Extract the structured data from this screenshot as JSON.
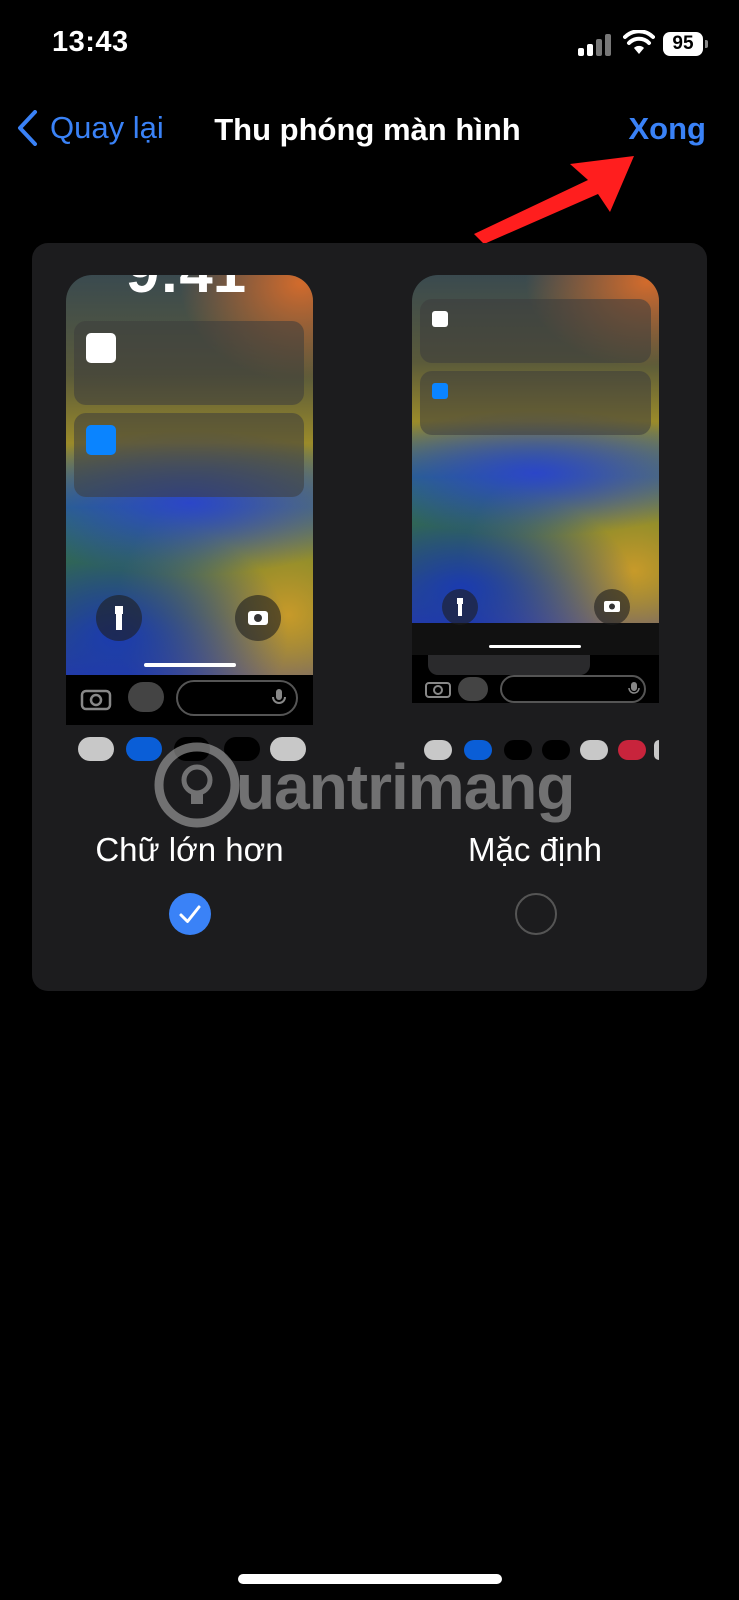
{
  "status_bar": {
    "time": "13:43",
    "battery": "95"
  },
  "nav": {
    "back_label": "Quay lại",
    "title": "Thu phóng màn hình",
    "done_label": "Xong"
  },
  "options": [
    {
      "label": "Chữ lớn hơn",
      "selected": true
    },
    {
      "label": "Mặc định",
      "selected": false
    }
  ],
  "preview_large": {
    "clock_partial": "9:41"
  },
  "watermark": "uantrimang",
  "colors": {
    "accent": "#3a82f7",
    "annotation_arrow": "#ff1e1e",
    "card_bg": "#1c1c1e"
  }
}
